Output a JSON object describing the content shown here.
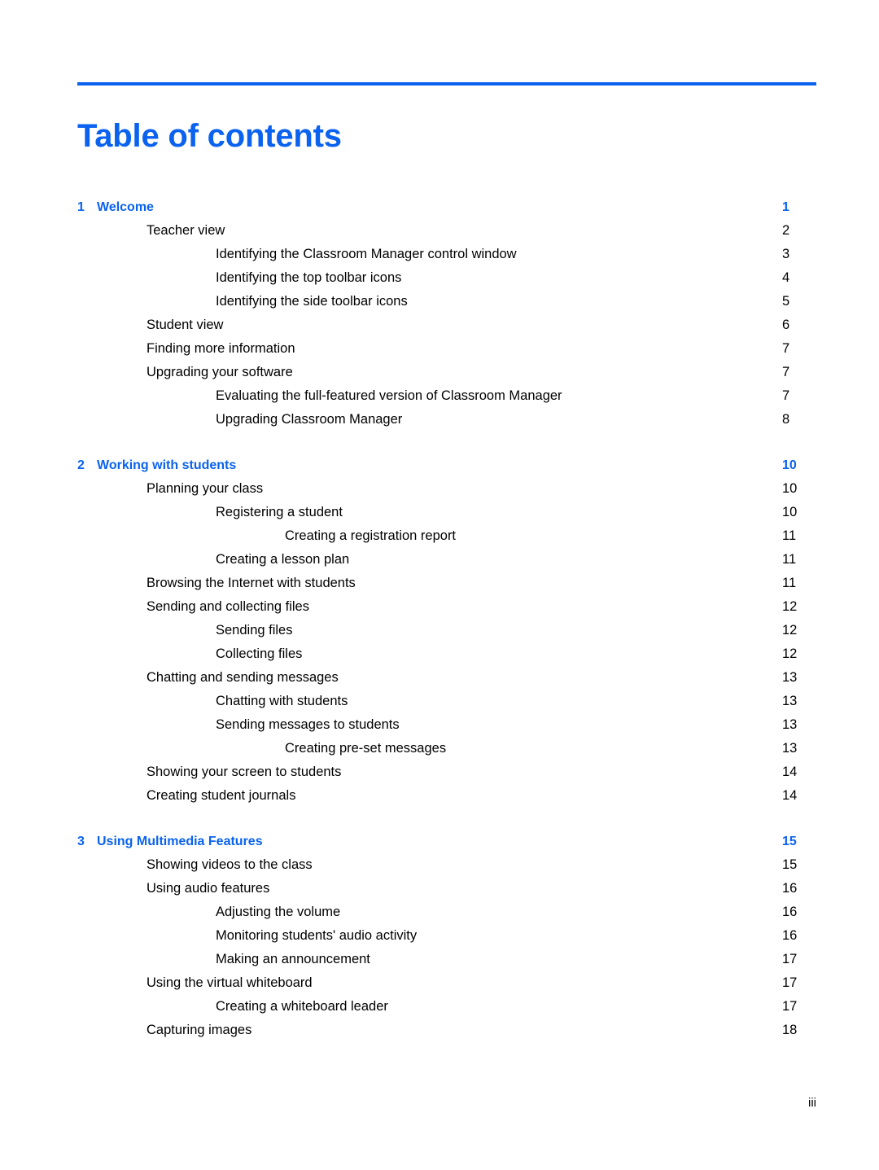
{
  "document": {
    "title": "Table of contents",
    "folio": "iii",
    "accent_color": "#0a62ef",
    "text_color": "#000000"
  },
  "toc": {
    "entries": [
      {
        "level": "chapter",
        "number": "1",
        "label": "Welcome",
        "page": "1"
      },
      {
        "level": "lvl1",
        "number": "",
        "label": "Teacher view",
        "page": "2"
      },
      {
        "level": "lvl2",
        "number": "",
        "label": "Identifying the Classroom Manager control window",
        "page": "3"
      },
      {
        "level": "lvl2",
        "number": "",
        "label": "Identifying the top toolbar icons",
        "page": "4"
      },
      {
        "level": "lvl2",
        "number": "",
        "label": "Identifying the side toolbar icons",
        "page": "5"
      },
      {
        "level": "lvl1",
        "number": "",
        "label": "Student view",
        "page": "6"
      },
      {
        "level": "lvl1",
        "number": "",
        "label": "Finding more information",
        "page": "7"
      },
      {
        "level": "lvl1",
        "number": "",
        "label": "Upgrading your software",
        "page": "7"
      },
      {
        "level": "lvl2",
        "number": "",
        "label": "Evaluating the full-featured version of Classroom Manager",
        "page": "7"
      },
      {
        "level": "lvl2",
        "number": "",
        "label": "Upgrading Classroom Manager",
        "page": "8"
      },
      {
        "level": "chapter",
        "number": "2",
        "label": "Working with students",
        "page": "10"
      },
      {
        "level": "lvl1",
        "number": "",
        "label": "Planning your class",
        "page": "10"
      },
      {
        "level": "lvl2",
        "number": "",
        "label": "Registering a student",
        "page": "10"
      },
      {
        "level": "lvl3",
        "number": "",
        "label": "Creating a registration report",
        "page": "11"
      },
      {
        "level": "lvl2",
        "number": "",
        "label": "Creating a lesson plan",
        "page": "11"
      },
      {
        "level": "lvl1",
        "number": "",
        "label": "Browsing the Internet with students",
        "page": "11"
      },
      {
        "level": "lvl1",
        "number": "",
        "label": "Sending and collecting files",
        "page": "12"
      },
      {
        "level": "lvl2",
        "number": "",
        "label": "Sending files",
        "page": "12"
      },
      {
        "level": "lvl2",
        "number": "",
        "label": "Collecting files",
        "page": "12"
      },
      {
        "level": "lvl1",
        "number": "",
        "label": "Chatting and sending messages",
        "page": "13"
      },
      {
        "level": "lvl2",
        "number": "",
        "label": "Chatting with students",
        "page": "13"
      },
      {
        "level": "lvl2",
        "number": "",
        "label": "Sending messages to students",
        "page": "13"
      },
      {
        "level": "lvl3",
        "number": "",
        "label": "Creating pre-set messages",
        "page": "13"
      },
      {
        "level": "lvl1",
        "number": "",
        "label": "Showing your screen to students",
        "page": "14"
      },
      {
        "level": "lvl1",
        "number": "",
        "label": "Creating student journals",
        "page": "14"
      },
      {
        "level": "chapter",
        "number": "3",
        "label": "Using Multimedia Features",
        "page": "15"
      },
      {
        "level": "lvl1",
        "number": "",
        "label": "Showing videos to the class",
        "page": "15"
      },
      {
        "level": "lvl1",
        "number": "",
        "label": "Using audio features",
        "page": "16"
      },
      {
        "level": "lvl2",
        "number": "",
        "label": "Adjusting the volume",
        "page": "16"
      },
      {
        "level": "lvl2",
        "number": "",
        "label": "Monitoring students' audio activity",
        "page": "16"
      },
      {
        "level": "lvl2",
        "number": "",
        "label": "Making an announcement",
        "page": "17"
      },
      {
        "level": "lvl1",
        "number": "",
        "label": "Using the virtual whiteboard",
        "page": "17"
      },
      {
        "level": "lvl2",
        "number": "",
        "label": "Creating a whiteboard leader",
        "page": "17"
      },
      {
        "level": "lvl1",
        "number": "",
        "label": "Capturing images",
        "page": "18"
      }
    ]
  }
}
